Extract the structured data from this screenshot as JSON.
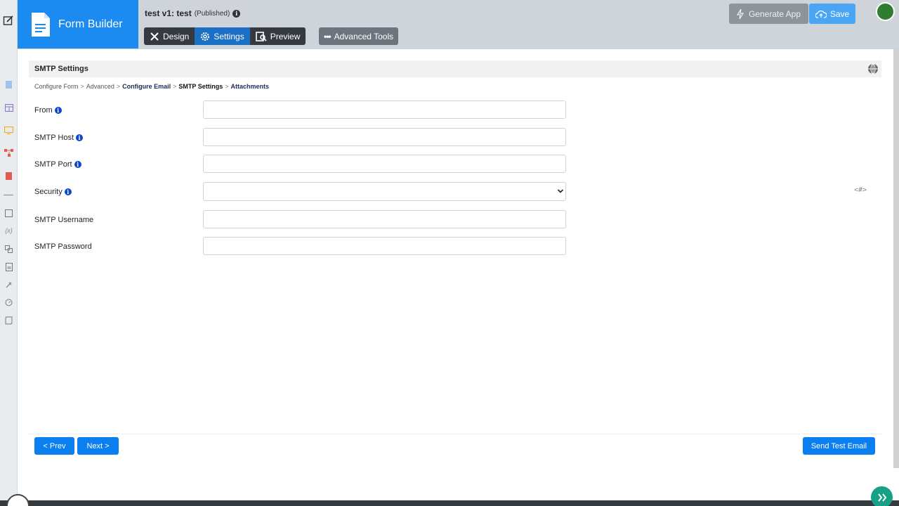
{
  "header": {
    "app_name": "Form Builder",
    "form_title": "test v1: test",
    "form_status": "(Published)",
    "tabs": [
      {
        "label": "Design"
      },
      {
        "label": "Settings"
      },
      {
        "label": "Preview"
      }
    ],
    "advanced_tools": "Advanced Tools",
    "generate_app": "Generate App",
    "save": "Save"
  },
  "panel": {
    "title": "SMTP Settings"
  },
  "breadcrumb": {
    "items": [
      "Configure Form",
      "Advanced",
      "Configure Email",
      "SMTP Settings",
      "Attachments"
    ],
    "separator": ">"
  },
  "form": {
    "fields": [
      {
        "label": "From",
        "value": "",
        "has_info": true
      },
      {
        "label": "SMTP Host",
        "value": "",
        "has_info": true
      },
      {
        "label": "SMTP Port",
        "value": "",
        "has_info": true
      },
      {
        "label": "Security",
        "value": "",
        "has_info": true
      },
      {
        "label": "SMTP Username",
        "value": "",
        "has_info": false
      },
      {
        "label": "SMTP Password",
        "value": "",
        "has_info": false
      }
    ],
    "code_token": "<#>"
  },
  "footer": {
    "prev": "< Prev",
    "next": "Next >",
    "send_test": "Send Test Email"
  },
  "colors": {
    "brand": "#1b8af1",
    "primary_button": "#0b7ff0",
    "header_bg": "#ced4da",
    "fab": "#16a085"
  }
}
